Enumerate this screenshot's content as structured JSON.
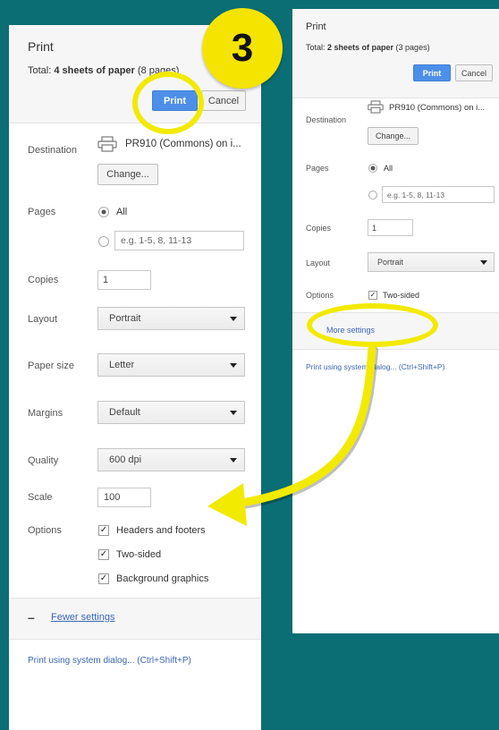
{
  "annotation": {
    "step_number": "3",
    "color": "#f2ea00"
  },
  "left_dialog": {
    "title": "Print",
    "total_bold": "4 sheets of paper",
    "total_prefix": "Total: ",
    "total_suffix": " (8 pages)",
    "print_label": "Print",
    "cancel_label": "Cancel",
    "destination_label": "Destination",
    "destination_value": "PR910 (Commons) on i...",
    "change_label": "Change...",
    "pages_label": "Pages",
    "pages_all": "All",
    "pages_placeholder": "e.g. 1-5, 8, 11-13",
    "copies_label": "Copies",
    "copies_value": "1",
    "layout_label": "Layout",
    "layout_value": "Portrait",
    "paper_size_label": "Paper size",
    "paper_size_value": "Letter",
    "margins_label": "Margins",
    "margins_value": "Default",
    "quality_label": "Quality",
    "quality_value": "600 dpi",
    "scale_label": "Scale",
    "scale_value": "100",
    "options_label": "Options",
    "options": [
      {
        "label": "Headers and footers",
        "checked": true
      },
      {
        "label": "Two-sided",
        "checked": true
      },
      {
        "label": "Background graphics",
        "checked": true
      }
    ],
    "collapse_symbol": "–",
    "fewer_settings": "Fewer settings",
    "system_dialog": "Print using system dialog... (Ctrl+Shift+P)"
  },
  "right_dialog": {
    "title": "Print",
    "total_prefix": "Total: ",
    "total_bold": "2 sheets of paper",
    "total_suffix": " (3 pages)",
    "print_label": "Print",
    "cancel_label": "Cancel",
    "destination_label": "Destination",
    "destination_value": "PR910 (Commons) on i...",
    "change_label": "Change...",
    "pages_label": "Pages",
    "pages_all": "All",
    "pages_placeholder": "e.g. 1-5, 8, 11-13",
    "copies_label": "Copies",
    "copies_value": "1",
    "layout_label": "Layout",
    "layout_value": "Portrait",
    "options_label": "Options",
    "options": [
      {
        "label": "Two-sided",
        "checked": true
      }
    ],
    "more_settings": "More settings",
    "system_dialog": "Print using system dialog... (Ctrl+Shift+P)"
  },
  "colors": {
    "background": "#0b6e74",
    "primary_button": "#4d8fe8",
    "link": "#3b67b7"
  }
}
